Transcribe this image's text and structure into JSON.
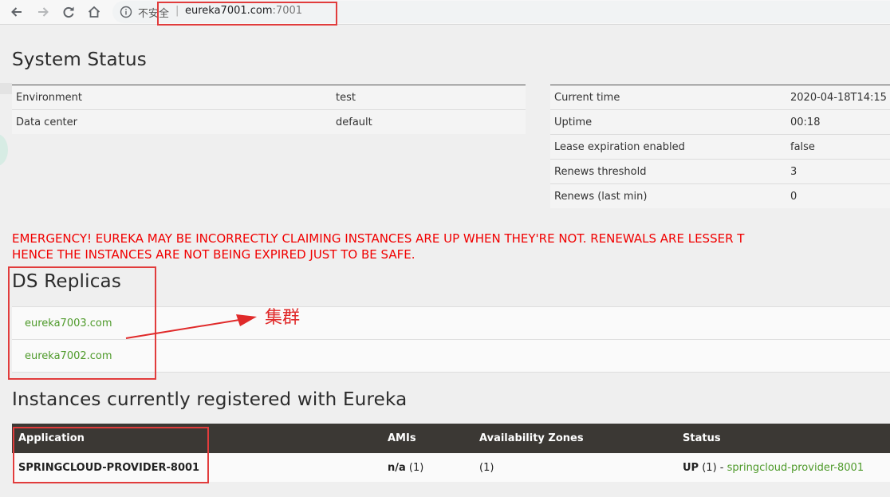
{
  "browser": {
    "security_label": "不安全",
    "separator": "|",
    "url_host": "eureka7001.com",
    "url_port": ":7001"
  },
  "system_status": {
    "title": "System Status",
    "left": [
      {
        "key": "Environment",
        "value": "test"
      },
      {
        "key": "Data center",
        "value": "default"
      }
    ],
    "right": [
      {
        "key": "Current time",
        "value": "2020-04-18T14:15"
      },
      {
        "key": "Uptime",
        "value": "00:18"
      },
      {
        "key": "Lease expiration enabled",
        "value": "false"
      },
      {
        "key": "Renews threshold",
        "value": "3"
      },
      {
        "key": "Renews (last min)",
        "value": "0"
      }
    ]
  },
  "emergency": {
    "line1": "EMERGENCY! EUREKA MAY BE INCORRECTLY CLAIMING INSTANCES ARE UP WHEN THEY'RE NOT. RENEWALS ARE LESSER T",
    "line2": "HENCE THE INSTANCES ARE NOT BEING EXPIRED JUST TO BE SAFE."
  },
  "replicas": {
    "title": "DS Replicas",
    "items": [
      "eureka7003.com",
      "eureka7002.com"
    ],
    "annotation": "集群"
  },
  "instances": {
    "title": "Instances currently registered with Eureka",
    "headers": [
      "Application",
      "AMIs",
      "Availability Zones",
      "Status"
    ],
    "rows": [
      {
        "application": "SPRINGCLOUD-PROVIDER-8001",
        "amis": "n/a",
        "amis_count": "(1)",
        "zones": "(1)",
        "status": "UP",
        "status_count": "(1) -",
        "instance_link": "springcloud-provider-8001"
      }
    ]
  },
  "colors": {
    "emergency": "#f00000",
    "link": "#4e9a2a",
    "table_header": "#3b3834",
    "annotation": "#e02a2a"
  }
}
